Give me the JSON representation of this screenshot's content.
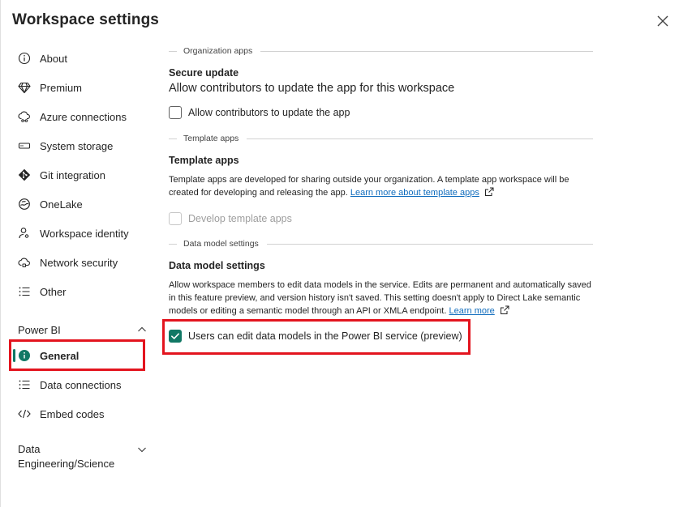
{
  "window": {
    "title": "Workspace settings"
  },
  "sidebar": {
    "items": [
      {
        "label": "About",
        "icon": "info-icon"
      },
      {
        "label": "Premium",
        "icon": "diamond-icon"
      },
      {
        "label": "Azure connections",
        "icon": "cloud-link-icon"
      },
      {
        "label": "System storage",
        "icon": "storage-icon"
      },
      {
        "label": "Git integration",
        "icon": "git-icon"
      },
      {
        "label": "OneLake",
        "icon": "onelake-icon"
      },
      {
        "label": "Workspace identity",
        "icon": "identity-icon"
      },
      {
        "label": "Network security",
        "icon": "network-icon"
      },
      {
        "label": "Other",
        "icon": "list-icon"
      }
    ],
    "power_bi": {
      "heading": "Power BI",
      "items": [
        {
          "label": "General",
          "icon": "info-filled-icon",
          "active": true
        },
        {
          "label": "Data connections",
          "icon": "list-icon"
        },
        {
          "label": "Embed codes",
          "icon": "code-icon"
        }
      ]
    },
    "data_eng": {
      "heading_line1": "Data",
      "heading_line2": "Engineering/Science"
    }
  },
  "main": {
    "org_apps": {
      "divider": "Organization apps",
      "heading": "Secure update",
      "description": "Allow contributors to update the app for this workspace",
      "checkbox_label": "Allow contributors to update the app",
      "checked": false
    },
    "template_apps": {
      "divider": "Template apps",
      "heading": "Template apps",
      "description": "Template apps are developed for sharing outside your organization. A template app workspace will be created for developing and releasing the app.",
      "link": "Learn more about template apps",
      "checkbox_label": "Develop template apps",
      "checked": false,
      "disabled": true
    },
    "data_model": {
      "divider": "Data model settings",
      "heading": "Data model settings",
      "description": "Allow workspace members to edit data models in the service. Edits are permanent and automatically saved in this feature preview, and version history isn't saved. This setting doesn't apply to Direct Lake semantic models or editing a semantic model through an API or XMLA endpoint.",
      "link": "Learn more",
      "checkbox_label": "Users can edit data models in the Power BI service (preview)",
      "checked": true
    }
  },
  "colors": {
    "accent": "#117865",
    "link": "#0f6cbd",
    "highlight": "#e3141e"
  }
}
